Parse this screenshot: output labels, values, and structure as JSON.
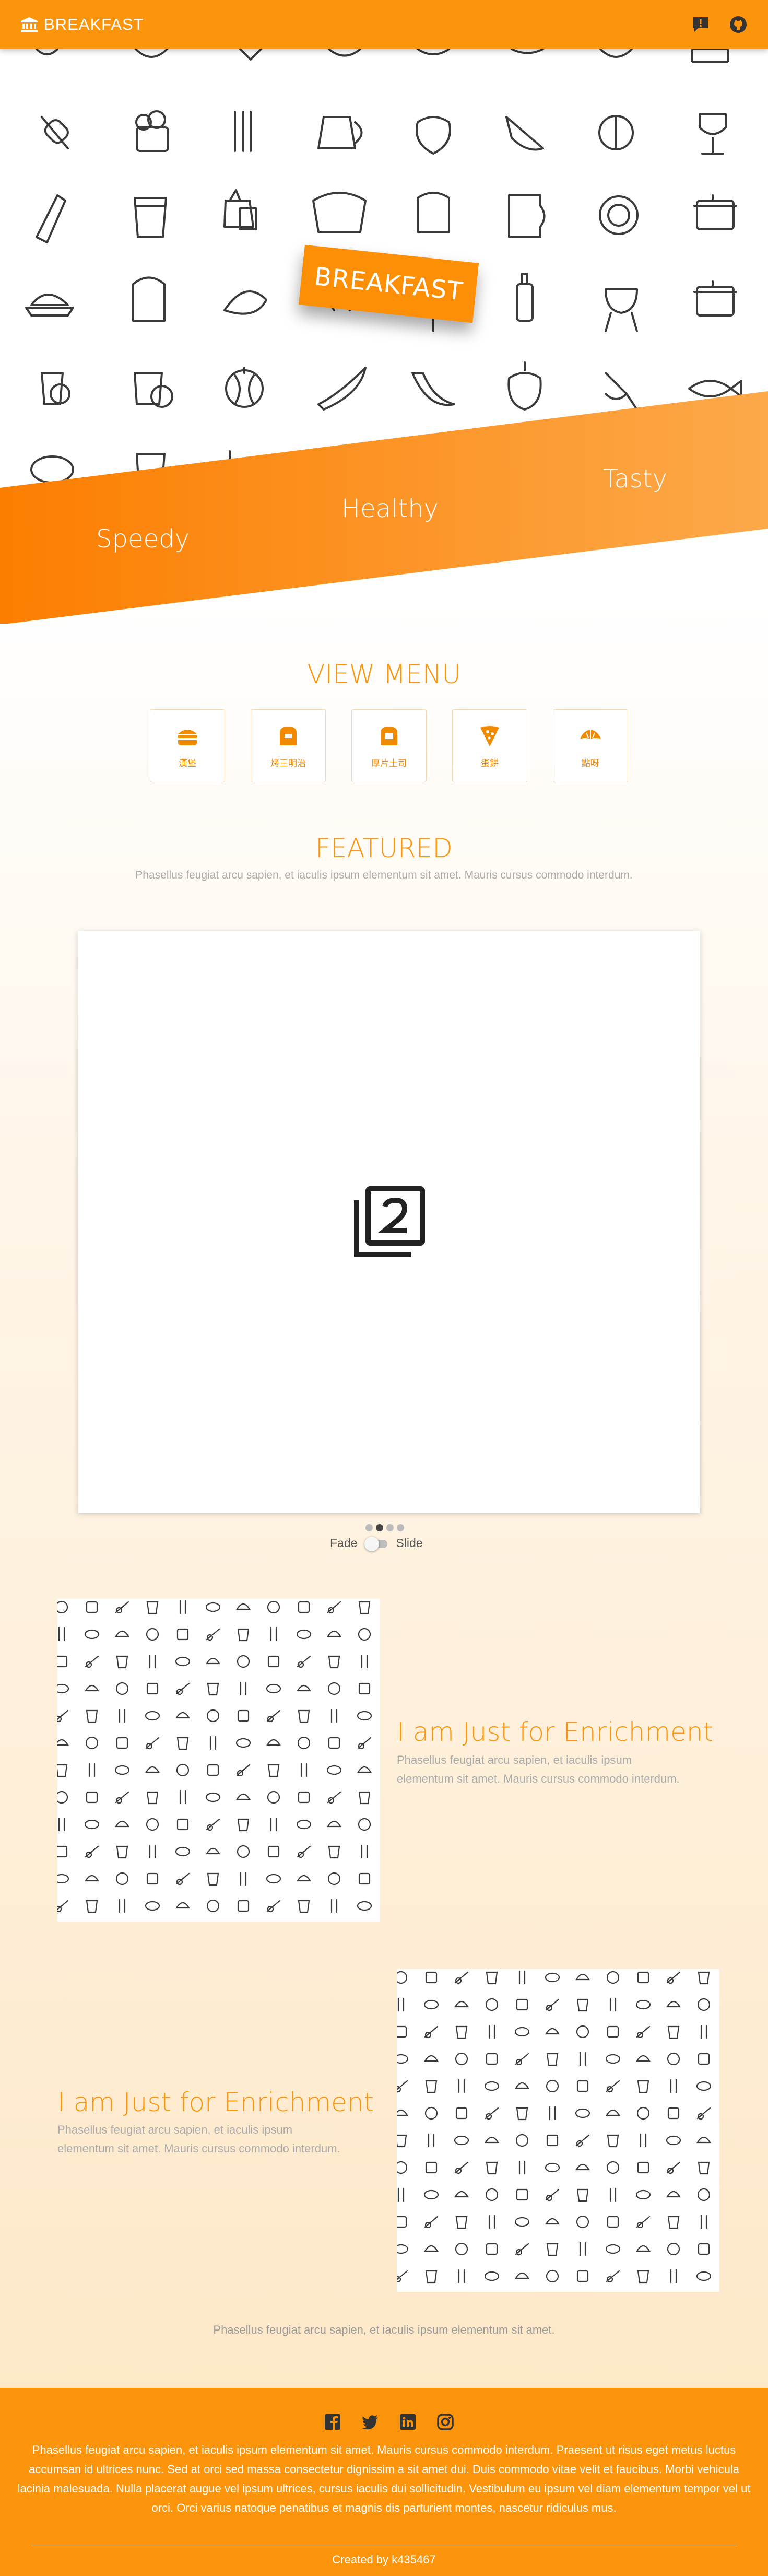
{
  "navbar": {
    "brand": "BREAKFAST",
    "brand_icon": "bank-icon",
    "right_icons": [
      "announcement-icon",
      "github-icon"
    ]
  },
  "hero": {
    "banner_label": "BREAKFAST",
    "taglines": [
      "Speedy",
      "Healthy",
      "Tasty"
    ],
    "accent_color": "#fc950b"
  },
  "view_menu": {
    "title": "VIEW MENU",
    "items": [
      {
        "label": "漢堡",
        "icon": "burger-icon"
      },
      {
        "label": "烤三明治",
        "icon": "toast-icon"
      },
      {
        "label": "厚片土司",
        "icon": "thick-toast-icon"
      },
      {
        "label": "蛋餅",
        "icon": "pizza-slice-icon"
      },
      {
        "label": "點呀",
        "icon": "croissant-icon"
      }
    ]
  },
  "featured": {
    "title": "FEATURED",
    "subtitle": "Phasellus feugiat arcu sapien, et iaculis ipsum elementum sit amet. Mauris cursus commodo interdum.",
    "slide_icon": "filter-2-icon",
    "slides_total": 4,
    "active_slide": 2,
    "transition_left": "Fade",
    "transition_right": "Slide"
  },
  "enrichment": [
    {
      "title": "I am Just for Enrichment",
      "text": "Phasellus feugiat arcu sapien, et iaculis ipsum elementum sit amet. Mauris cursus commodo interdum."
    },
    {
      "title": "I am Just for Enrichment",
      "text": "Phasellus feugiat arcu sapien, et iaculis ipsum elementum sit amet. Mauris cursus commodo interdum."
    }
  ],
  "bottom_note": "Phasellus feugiat arcu sapien, et iaculis ipsum elementum sit amet.",
  "footer": {
    "social_icons": [
      "facebook-icon",
      "twitter-icon",
      "linkedin-icon",
      "instagram-icon"
    ],
    "text": "Phasellus feugiat arcu sapien, et iaculis ipsum elementum sit amet. Mauris cursus commodo interdum. Praesent ut risus eget metus luctus accumsan id ultrices nunc. Sed at orci sed massa consectetur dignissim a sit amet dui. Duis commodo vitae velit et faucibus. Morbi vehicula lacinia malesuada. Nulla placerat augue vel ipsum ultrices, cursus iaculis dui sollicitudin. Vestibulum eu ipsum vel diam elementum tempor vel ut orci. Orci varius natoque penatibus et magnis dis parturient montes, nascetur ridiculus mus.",
    "credit": "Created by k435467"
  }
}
